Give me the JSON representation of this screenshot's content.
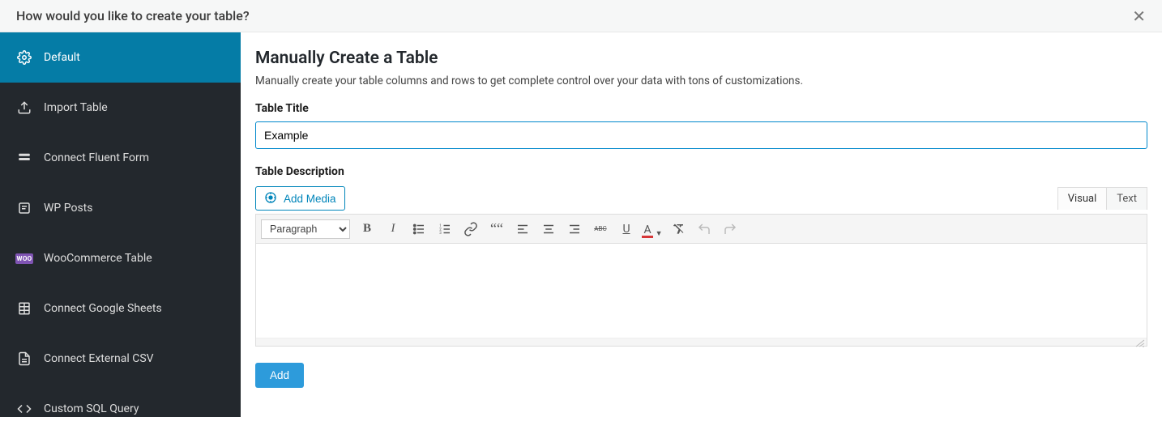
{
  "header": {
    "title": "How would you like to create your table?"
  },
  "sidebar": {
    "items": [
      {
        "label": "Default"
      },
      {
        "label": "Import Table"
      },
      {
        "label": "Connect Fluent Form"
      },
      {
        "label": "WP Posts"
      },
      {
        "label": "WooCommerce Table",
        "badge": "WOO"
      },
      {
        "label": "Connect Google Sheets"
      },
      {
        "label": "Connect External CSV"
      },
      {
        "label": "Custom SQL Query"
      }
    ]
  },
  "main": {
    "title": "Manually Create a Table",
    "subtitle": "Manually create your table columns and rows to get complete control over your data with tons of customizations.",
    "title_label": "Table Title",
    "title_value": "Example",
    "desc_label": "Table Description",
    "add_media_label": "Add Media",
    "tabs": {
      "visual": "Visual",
      "text": "Text"
    },
    "format_select": "Paragraph",
    "add_button": "Add",
    "abc_label": "ABC",
    "underline_label": "U",
    "color_letter": "A"
  }
}
